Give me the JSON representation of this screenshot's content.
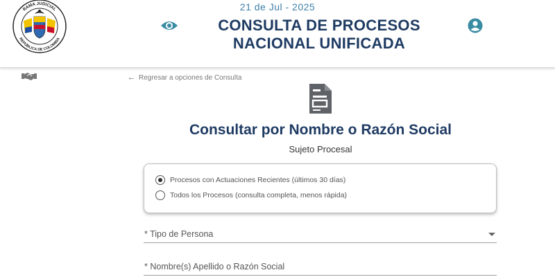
{
  "header": {
    "date": "21 de Jul - 2025",
    "title_line1": "CONSULTA DE PROCESOS",
    "title_line2": "NACIONAL UNIFICADA",
    "logo_text_top": "RAMA JUDICIAL",
    "logo_text_bottom": "REPÚBLICA DE COLOMBIA",
    "icons": [
      "eye-icon",
      "user-account-icon"
    ]
  },
  "sidebar": {
    "icons": [
      "handshake-icon"
    ]
  },
  "back_link": "Regresar a opciones de Consulta",
  "page": {
    "icon": "document-icon",
    "title": "Consultar por Nombre o Razón Social",
    "subtitle": "Sujeto Procesal"
  },
  "options": [
    {
      "label": "Procesos con Actuaciones Recientes (últimos 30 días)",
      "checked": true
    },
    {
      "label": "Todos los Procesos (consulta completa, menos rápida)",
      "checked": false
    }
  ],
  "fields": {
    "tipo_persona": {
      "label": "* Tipo de Persona",
      "value": ""
    },
    "nombre": {
      "label": "* Nombre(s) Apellido o Razón Social",
      "value": ""
    }
  },
  "colors": {
    "title": "#1f3b63",
    "date": "#3d7fa6",
    "icon_teal": "#3a8ca3",
    "doc_icon": "#5f6368"
  }
}
